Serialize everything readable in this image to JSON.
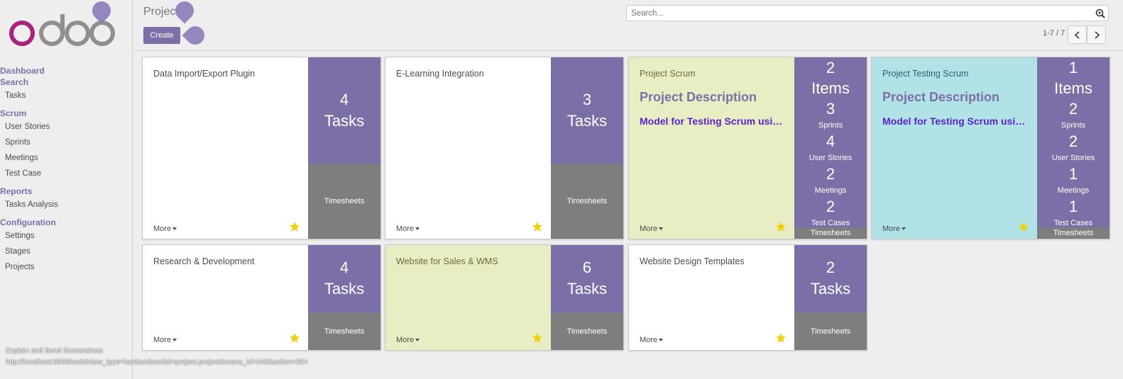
{
  "app": {
    "logo_text": "odoo"
  },
  "sidebar": {
    "sections": [
      {
        "label": "Dashboard"
      },
      {
        "label": "Search",
        "items": [
          "Tasks"
        ]
      },
      {
        "label": "Scrum",
        "items": [
          "User Stories",
          "Sprints",
          "Meetings",
          "Test Case"
        ]
      },
      {
        "label": "Reports",
        "items": [
          "Tasks Analysis"
        ]
      },
      {
        "label": "Configuration",
        "items": [
          "Settings",
          "Stages",
          "Projects"
        ]
      }
    ]
  },
  "header": {
    "title": "Projec",
    "create_label": "Create",
    "search_placeholder": "Search...",
    "pager_text": "1-7 / 7"
  },
  "status": {
    "line1": "Explain and Send Screenshots",
    "line2": "http://localhost:8069/web#view_type=kanban&model=project.project&menu_id=246&action=364"
  },
  "cards": [
    {
      "name": "Data Import/Export Plugin",
      "count": "4",
      "count_label": "Tasks",
      "timesheets": "Timesheets",
      "more": "More"
    },
    {
      "name": "E-Learning Integration",
      "count": "3",
      "count_label": "Tasks",
      "timesheets": "Timesheets",
      "more": "More"
    },
    {
      "name": "Project Scrum",
      "desc_title": "Project Description",
      "desc_text": "Model for Testing Scrum using Odoo",
      "stats": {
        "items": "2",
        "items_label": "Items",
        "sprints": "3",
        "sprints_label": "Sprints",
        "stories": "4",
        "stories_label": "User Stories",
        "meetings": "2",
        "meetings_label": "Meetings",
        "tests": "2",
        "tests_label": "Test Cases"
      },
      "timesheets": "Timesheets",
      "more": "More"
    },
    {
      "name": "Project Testing Scrum",
      "desc_title": "Project Description",
      "desc_text": "Model for Testing Scrum using Odoo",
      "stats": {
        "items": "1",
        "items_label": "Items",
        "sprints": "2",
        "sprints_label": "Sprints",
        "stories": "2",
        "stories_label": "User Stories",
        "meetings": "1",
        "meetings_label": "Meetings",
        "tests": "1",
        "tests_label": "Test Cases"
      },
      "timesheets": "Timesheets",
      "more": "More"
    },
    {
      "name": "Research & Development",
      "count": "4",
      "count_label": "Tasks",
      "timesheets": "Timesheets",
      "more": "More"
    },
    {
      "name": "Website for Sales & WMS",
      "count": "6",
      "count_label": "Tasks",
      "timesheets": "Timesheets",
      "more": "More"
    },
    {
      "name": "Website Design Templates",
      "count": "2",
      "count_label": "Tasks",
      "timesheets": "Timesheets",
      "more": "More"
    }
  ],
  "colors": {
    "brand": "#7c6fa8",
    "timesheet_gray": "#7e7e7e",
    "card_green": "#e8edc4",
    "card_cyan": "#b1e3e6",
    "star": "#f0d000"
  },
  "icons": {
    "search": "search-icon",
    "star": "star-icon",
    "prev": "chevron-left-icon",
    "next": "chevron-right-icon"
  }
}
